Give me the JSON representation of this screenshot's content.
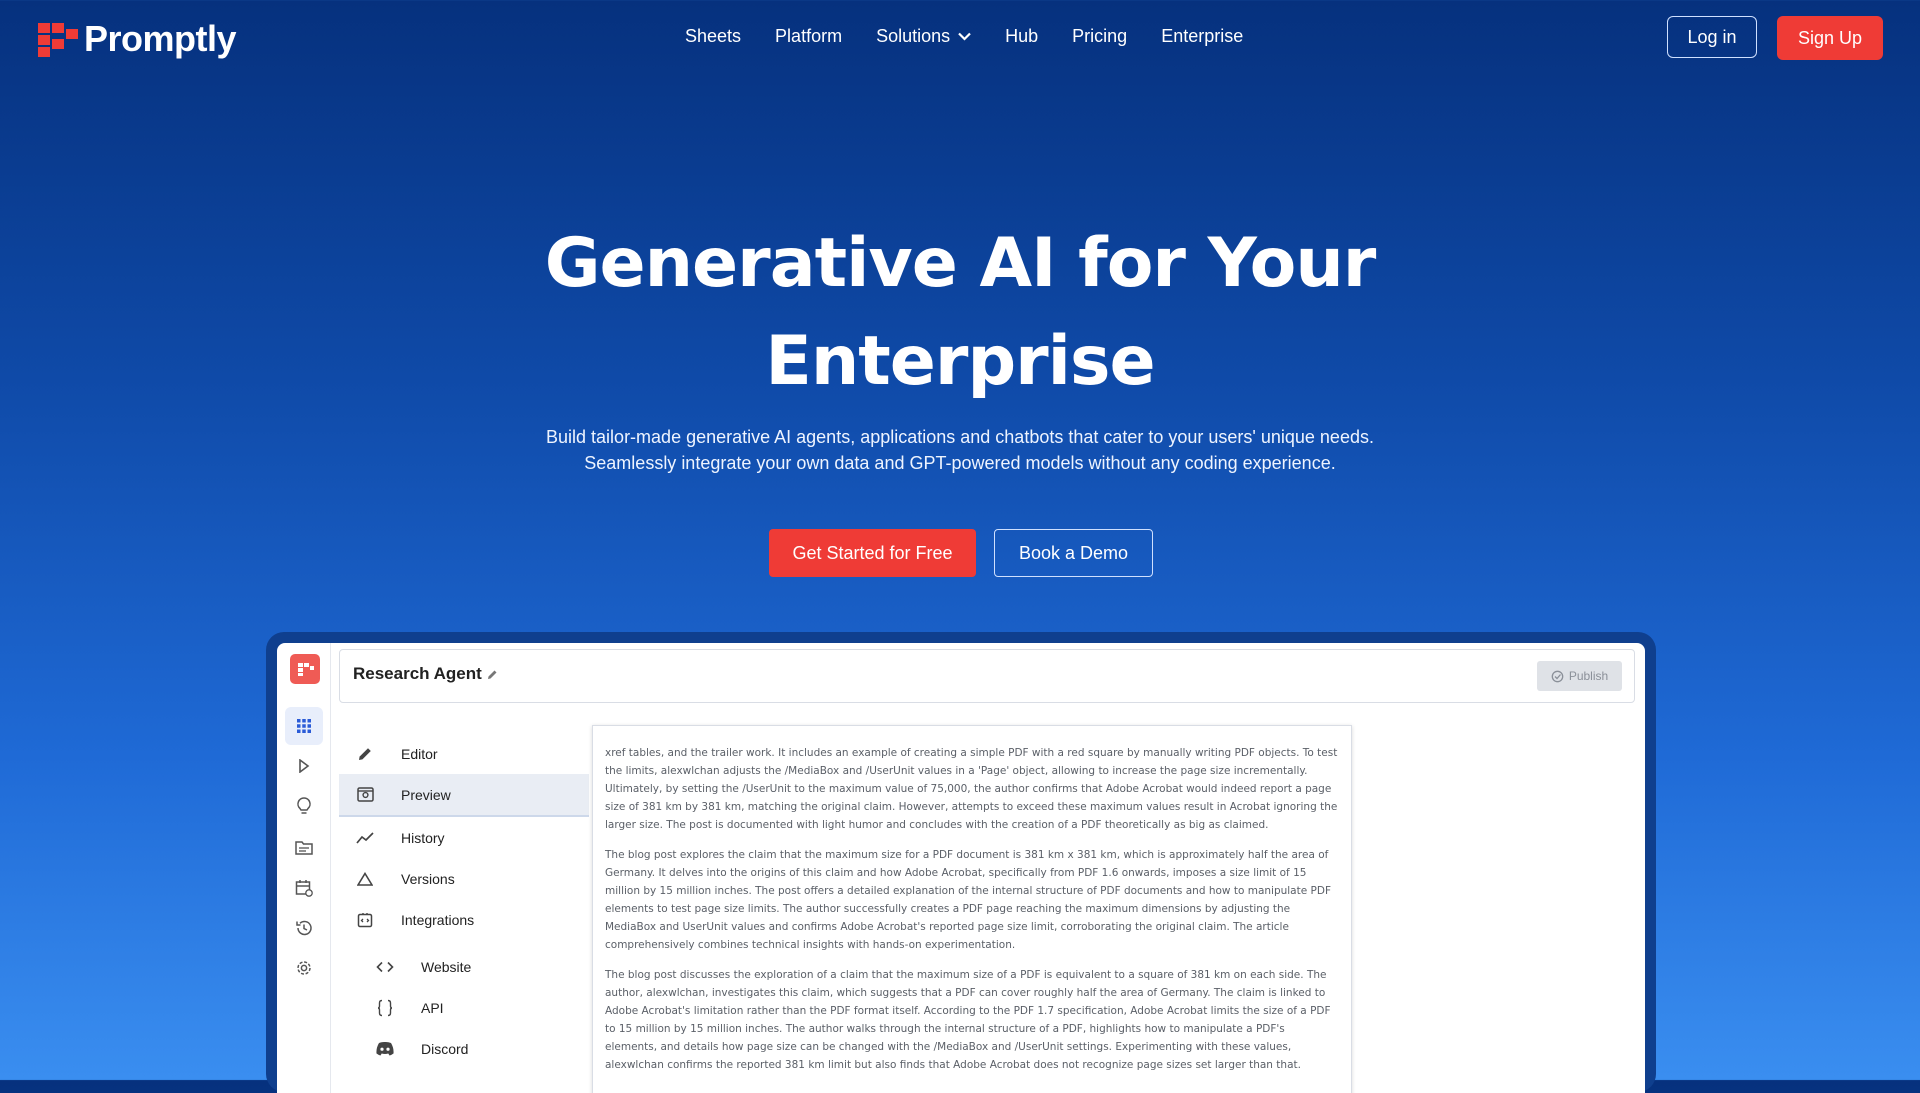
{
  "brand": {
    "name": "Promptly",
    "accent": "#ef3b36"
  },
  "nav": {
    "links": [
      "Sheets",
      "Platform",
      "Solutions",
      "Hub",
      "Pricing",
      "Enterprise"
    ],
    "login": "Log in",
    "signup": "Sign Up"
  },
  "hero": {
    "title_line1": "Generative AI for Your",
    "title_line2": "Enterprise",
    "subtitle_line1": "Build tailor-made generative AI agents, applications and chatbots that cater to your users' unique needs.",
    "subtitle_line2": "Seamlessly integrate your own data and GPT-powered models without any coding experience.",
    "cta_primary": "Get Started for Free",
    "cta_secondary": "Book a Demo"
  },
  "app": {
    "title": "Research Agent",
    "publish": "Publish",
    "rail_icons": [
      "apps-grid-icon",
      "play-icon",
      "lightbulb-icon",
      "folder-icon",
      "calendar-icon",
      "history-icon",
      "gear-icon"
    ],
    "menu": [
      {
        "label": "Editor",
        "icon": "pencil-icon"
      },
      {
        "label": "Preview",
        "icon": "preview-icon"
      },
      {
        "label": "History",
        "icon": "chart-line-icon"
      },
      {
        "label": "Versions",
        "icon": "triangle-icon"
      },
      {
        "label": "Integrations",
        "icon": "integrations-icon"
      }
    ],
    "submenu": [
      {
        "label": "Website",
        "icon": "code-icon"
      },
      {
        "label": "API",
        "icon": "braces-icon"
      },
      {
        "label": "Discord",
        "icon": "discord-icon"
      }
    ],
    "paragraphs": [
      "xref tables, and the trailer work. It includes an example of creating a simple PDF with a red square by manually writing PDF objects. To test the limits, alexwlchan adjusts the /MediaBox and /UserUnit values in a 'Page' object, allowing to increase the page size incrementally. Ultimately, by setting the /UserUnit to the maximum value of 75,000, the author confirms that Adobe Acrobat would indeed report a page size of 381 km by 381 km, matching the original claim. However, attempts to exceed these maximum values result in Acrobat ignoring the larger size. The post is documented with light humor and concludes with the creation of a PDF theoretically as big as claimed.",
      "The blog post explores the claim that the maximum size for a PDF document is 381 km x 381 km, which is approximately half the area of Germany. It delves into the origins of this claim and how Adobe Acrobat, specifically from PDF 1.6 onwards, imposes a size limit of 15 million by 15 million inches. The post offers a detailed explanation of the internal structure of PDF documents and how to manipulate PDF elements to test page size limits. The author successfully creates a PDF page reaching the maximum dimensions by adjusting the MediaBox and UserUnit values and confirms Adobe Acrobat's reported page size limit, corroborating the original claim. The article comprehensively combines technical insights with hands-on experimentation.",
      "The blog post discusses the exploration of a claim that the maximum size of a PDF is equivalent to a square of 381 km on each side. The author, alexwlchan, investigates this claim, which suggests that a PDF can cover roughly half the area of Germany. The claim is linked to Adobe Acrobat's limitation rather than the PDF format itself. According to the PDF 1.7 specification, Adobe Acrobat limits the size of a PDF to 15 million by 15 million inches. The author walks through the internal structure of a PDF, highlights how to manipulate a PDF's elements, and details how page size can be changed with the /MediaBox and /UserUnit settings. Experimenting with these values, alexwlchan confirms the reported 381 km limit but also finds that Adobe Acrobat does not recognize page sizes set larger than that."
    ]
  }
}
